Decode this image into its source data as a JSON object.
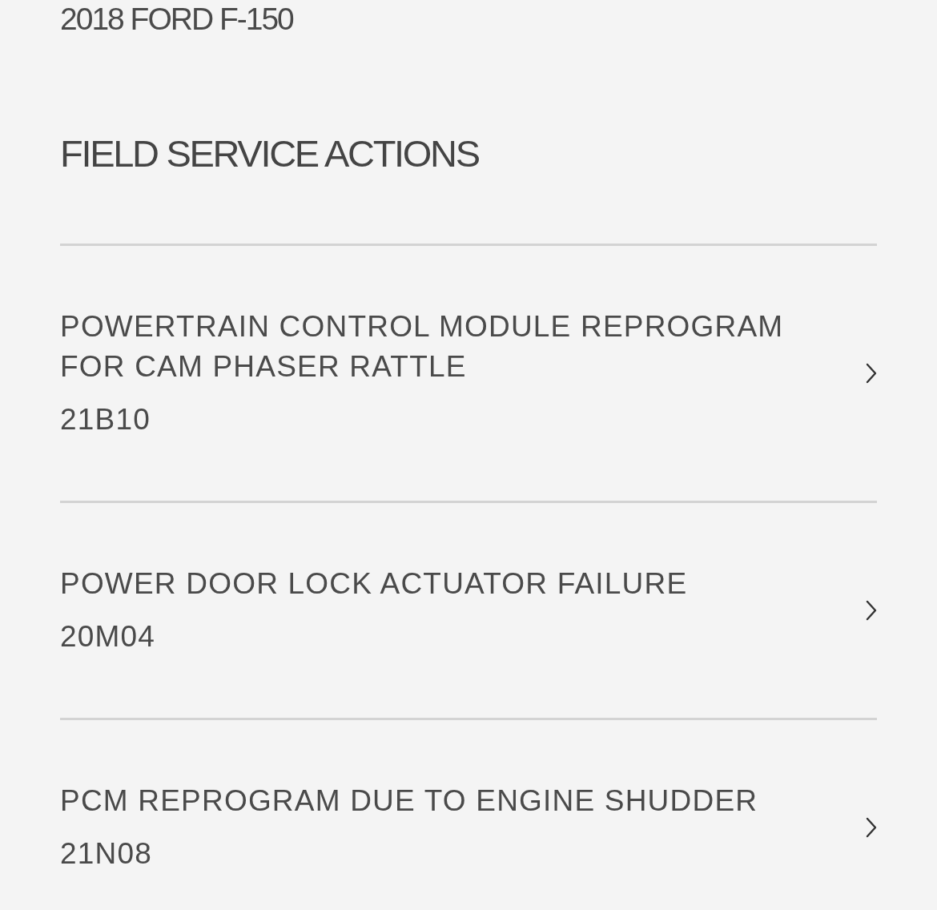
{
  "vehicle": {
    "title": "2018 FORD F-150"
  },
  "section": {
    "title": "FIELD SERVICE ACTIONS"
  },
  "actions": [
    {
      "title": "POWERTRAIN CONTROL MODULE REPROGRAM FOR CAM PHASER RATTLE",
      "code": "21B10"
    },
    {
      "title": "POWER DOOR LOCK ACTUATOR FAILURE",
      "code": "20M04"
    },
    {
      "title": "PCM REPROGRAM DUE TO ENGINE SHUDDER",
      "code": "21N08"
    }
  ]
}
